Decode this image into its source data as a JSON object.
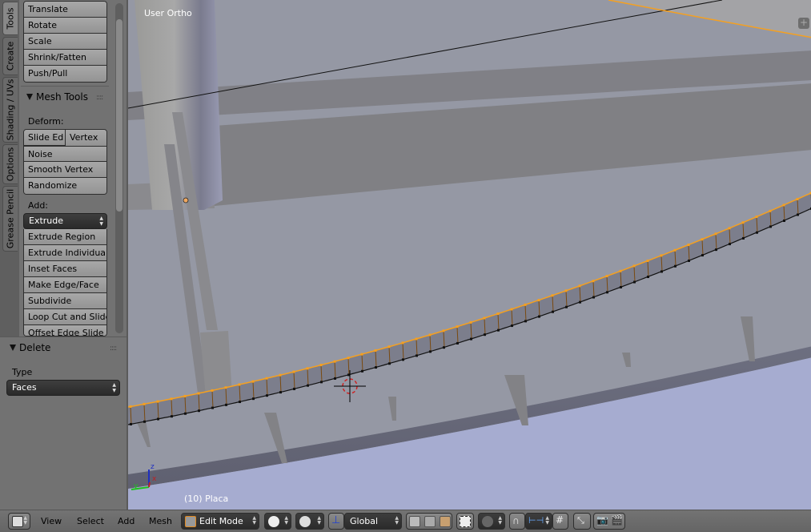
{
  "toolshelf": {
    "tabs": [
      "Tools",
      "Create",
      "Shading / UVs",
      "Options",
      "Grease Pencil"
    ],
    "active_tab": "Tools",
    "transform_buttons": [
      "Translate",
      "Rotate",
      "Scale",
      "Shrink/Fatten",
      "Push/Pull"
    ],
    "mesh_tools": {
      "title": "Mesh Tools",
      "deform_label": "Deform:",
      "deform_row": [
        "Slide Ed",
        "Vertex"
      ],
      "deform_buttons": [
        "Noise",
        "Smooth Vertex",
        "Randomize"
      ],
      "add_label": "Add:",
      "add_dropdown": "Extrude",
      "add_buttons": [
        "Extrude Region",
        "Extrude Individual",
        "Inset Faces",
        "Make Edge/Face",
        "Subdivide",
        "Loop Cut and Slide",
        "Offset Edge Slide"
      ]
    }
  },
  "operator_panel": {
    "title": "Delete",
    "type_label": "Type",
    "type_value": "Faces"
  },
  "viewport": {
    "view_name": "User Ortho",
    "object_label": "(10) Placa",
    "axis_labels": {
      "x": "x",
      "y": "y",
      "z": "z"
    },
    "colors": {
      "background": "#9598a4",
      "selected_edge": "#f5a020",
      "floor": "#a6acd0"
    }
  },
  "header": {
    "editor_type_icon": "3d-view-icon",
    "menus": [
      "View",
      "Select",
      "Add",
      "Mesh"
    ],
    "mode": "Edit Mode",
    "orientation": "Global"
  }
}
